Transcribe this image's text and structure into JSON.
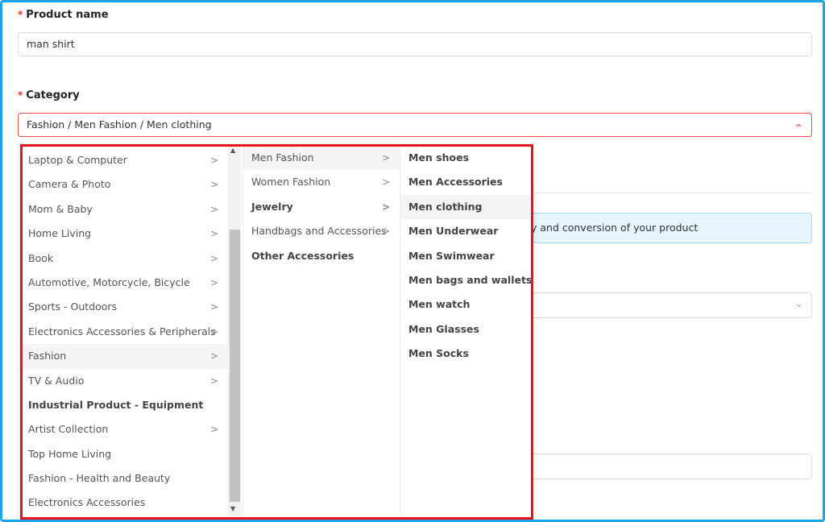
{
  "form": {
    "product_name_label": "Product name",
    "product_name_value": "man shirt",
    "category_label": "Category",
    "category_value": "Fashion / Men Fashion / Men clothing",
    "required_mark": "*"
  },
  "background": {
    "info_text": "y and conversion of your product"
  },
  "dropdown": {
    "col1": [
      {
        "label": "Laptop & Computer",
        "has_children": true
      },
      {
        "label": "Camera & Photo",
        "has_children": true
      },
      {
        "label": "Mom & Baby",
        "has_children": true
      },
      {
        "label": "Home Living",
        "has_children": true
      },
      {
        "label": "Book",
        "has_children": true
      },
      {
        "label": "Automotive, Motorcycle, Bicycle",
        "has_children": true
      },
      {
        "label": "Sports - Outdoors",
        "has_children": true
      },
      {
        "label": "Electronics Accessories & Peripherals",
        "has_children": true
      },
      {
        "label": "Fashion",
        "has_children": true,
        "selected": true
      },
      {
        "label": "TV & Audio",
        "has_children": true
      },
      {
        "label": "Industrial Product - Equipment",
        "has_children": false,
        "bold": true
      },
      {
        "label": "Artist Collection",
        "has_children": true
      },
      {
        "label": "Top Home Living",
        "has_children": false
      },
      {
        "label": "Fashion - Health and Beauty",
        "has_children": false
      },
      {
        "label": "Electronics Accessories",
        "has_children": false
      }
    ],
    "col2": [
      {
        "label": "Men Fashion",
        "has_children": true,
        "selected": true
      },
      {
        "label": "Women Fashion",
        "has_children": true
      },
      {
        "label": "Jewelry",
        "has_children": true,
        "bold": true
      },
      {
        "label": "Handbags and Accessories",
        "has_children": true
      },
      {
        "label": "Other Accessories",
        "has_children": false,
        "bold": true
      }
    ],
    "col3": [
      {
        "label": "Men shoes",
        "bold": true
      },
      {
        "label": "Men Accessories",
        "bold": true
      },
      {
        "label": "Men clothing",
        "bold": true,
        "selected": true
      },
      {
        "label": "Men Underwear",
        "bold": true
      },
      {
        "label": "Men Swimwear",
        "bold": true
      },
      {
        "label": "Men bags and wallets",
        "bold": true
      },
      {
        "label": "Men watch",
        "bold": true
      },
      {
        "label": "Men Glasses",
        "bold": true
      },
      {
        "label": "Men Socks",
        "bold": true
      }
    ]
  },
  "colors": {
    "frame_border": "#1aa3e8",
    "highlight_border": "#e8141b",
    "required": "#ee2b2b",
    "active_input_border": "#ee4d4d"
  },
  "icons": {
    "submenu_arrow": "chevron-right-icon",
    "category_toggle": "chevron-up-icon",
    "select_toggle": "chevron-down-icon"
  }
}
